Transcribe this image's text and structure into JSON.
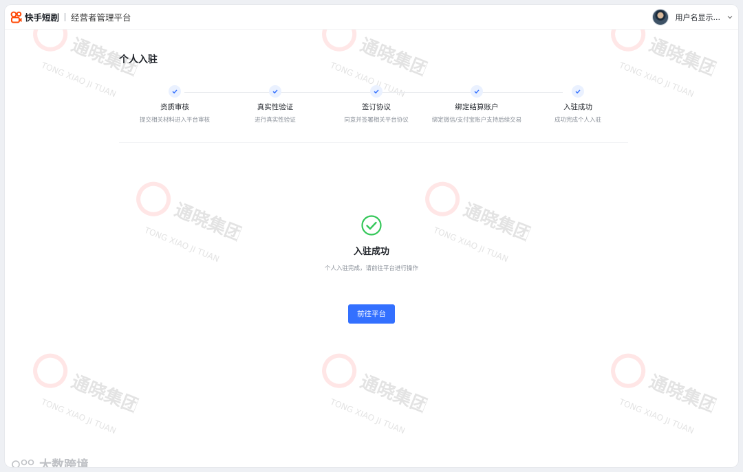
{
  "header": {
    "brand_name": "快手短剧",
    "platform_name": "经营者管理平台",
    "user_name": "用户名显示..."
  },
  "page": {
    "title": "个人入驻"
  },
  "steps": [
    {
      "title": "资质审核",
      "desc": "提交相关材料进入平台审核",
      "status": "done"
    },
    {
      "title": "真实性验证",
      "desc": "进行真实性验证",
      "status": "done"
    },
    {
      "title": "签订协议",
      "desc": "同意并签署相关平台协议",
      "status": "done"
    },
    {
      "title": "绑定结算账户",
      "desc": "绑定微信/支付宝账户支持后续交易",
      "status": "done"
    },
    {
      "title": "入驻成功",
      "desc": "成功完成个人入驻",
      "status": "done"
    }
  ],
  "result": {
    "title": "入驻成功",
    "desc": "个人入驻完成，请前往平台进行操作",
    "button_label": "前往平台"
  },
  "watermark": {
    "brand_cn": "通晓集团",
    "brand_en": "TONG XIAO JI TUAN"
  },
  "corner_mark": {
    "text": "大数跨境"
  },
  "colors": {
    "primary": "#3370ff",
    "success": "#34c759",
    "logo": "#ff4906"
  },
  "icons": [
    "kuaishou-logo-icon",
    "avatar",
    "chevron-down-icon",
    "check-icon",
    "success-check-circle-icon"
  ]
}
